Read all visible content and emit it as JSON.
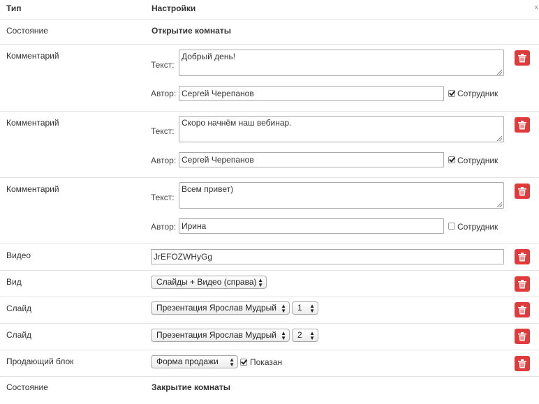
{
  "header": {
    "type_label": "Тип",
    "settings_label": "Настройки",
    "corner_mark": "x"
  },
  "rows": {
    "state_open": {
      "type": "Состояние",
      "value": "Открытие комнаты"
    },
    "comment1": {
      "type": "Комментарий",
      "text_label": "Текст:",
      "text": "Добрый день!",
      "author_label": "Автор:",
      "author": "Сергей Черепанов",
      "staff_label": "Сотрудник",
      "staff": true
    },
    "comment2": {
      "type": "Комментарий",
      "text_label": "Текст:",
      "text": "Скоро начнём наш вебинар.",
      "author_label": "Автор:",
      "author": "Сергей Черепанов",
      "staff_label": "Сотрудник",
      "staff": true
    },
    "comment3": {
      "type": "Комментарий",
      "text_label": "Текст:",
      "text": "Всем привет)",
      "author_label": "Автор:",
      "author": "Ирина",
      "staff_label": "Сотрудник",
      "staff": false
    },
    "video": {
      "type": "Видео",
      "value": "JrEFOZWHyGg"
    },
    "view": {
      "type": "Вид",
      "selected": "Слайды + Видео (справа)"
    },
    "slide1": {
      "type": "Слайд",
      "presentation": "Презентация Ярослав Мудрый",
      "number": "1"
    },
    "slide2": {
      "type": "Слайд",
      "presentation": "Презентация Ярослав Мудрый",
      "number": "2"
    },
    "sales": {
      "type": "Продающий блок",
      "selected": "Форма продажи",
      "shown_label": "Показан",
      "shown": true
    },
    "state_close": {
      "type": "Состояние",
      "value": "Закрытие комнаты"
    }
  },
  "colors": {
    "delete_button": "#e03a3a",
    "border": "#e4e4e4"
  },
  "icons": {
    "delete": "trash-icon",
    "select": "updown-arrows-icon"
  }
}
